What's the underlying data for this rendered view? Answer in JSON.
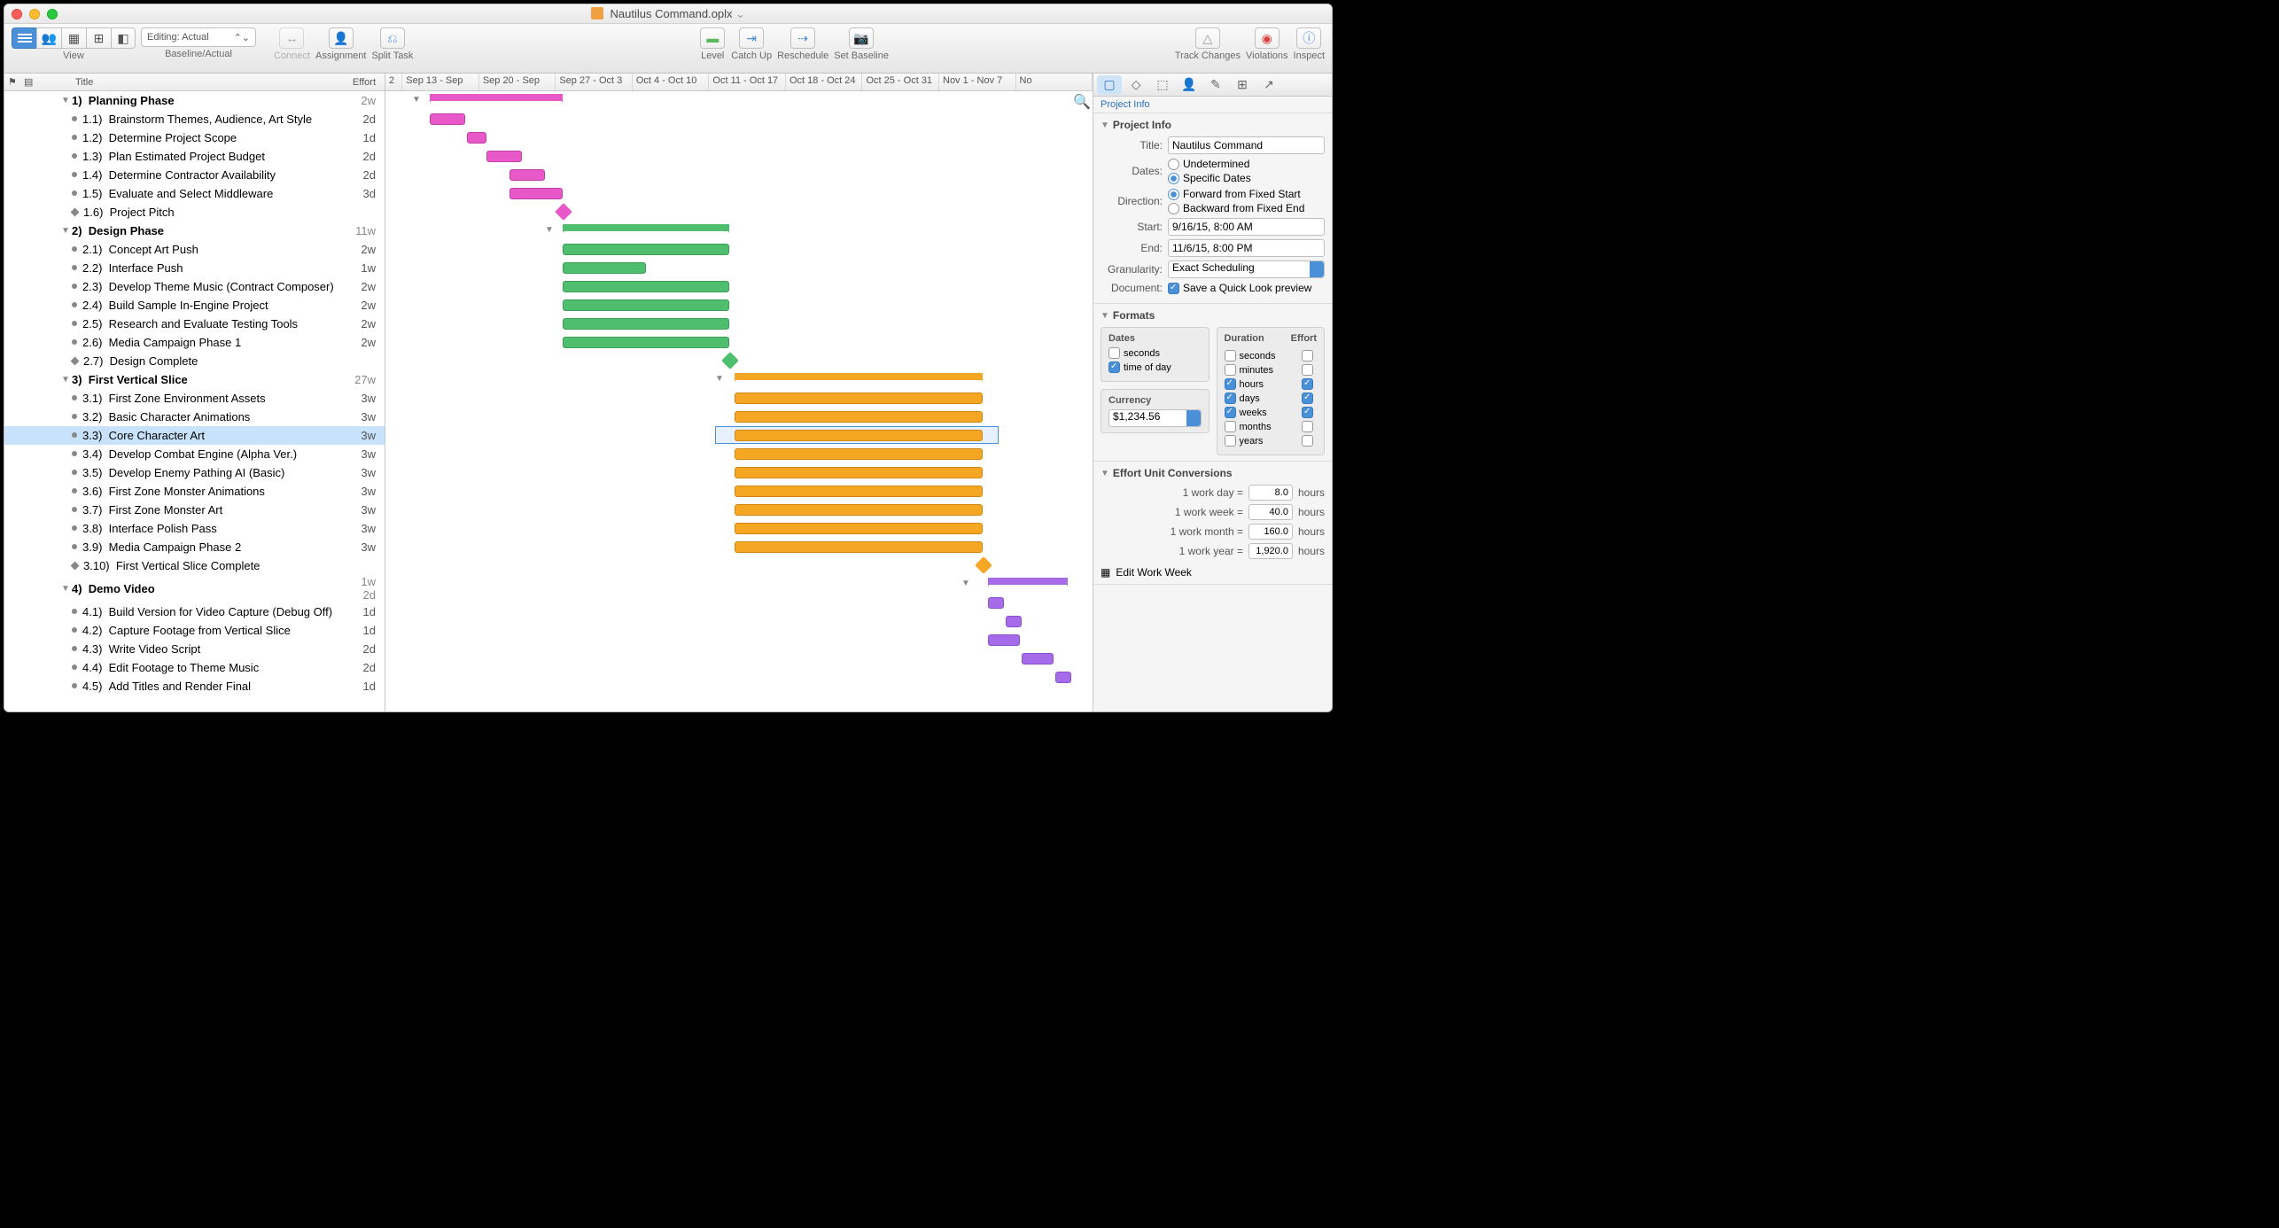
{
  "window": {
    "title": "Nautilus Command.oplx",
    "titleSuffix": "⌄"
  },
  "toolbar": {
    "view": "View",
    "baseline": "Baseline/Actual",
    "baselineSelect": "Editing: Actual",
    "connect": "Connect",
    "assignment": "Assignment",
    "split": "Split Task",
    "level": "Level",
    "catchup": "Catch Up",
    "reschedule": "Reschedule",
    "setbaseline": "Set Baseline",
    "track": "Track Changes",
    "violations": "Violations",
    "inspect": "Inspect"
  },
  "outline": {
    "headers": {
      "title": "Title",
      "effort": "Effort"
    },
    "rows": [
      {
        "type": "group",
        "id": "1",
        "label": "Planning Phase",
        "effort": "2w"
      },
      {
        "type": "task",
        "id": "1.1",
        "label": "Brainstorm Themes, Audience, Art Style",
        "effort": "2d"
      },
      {
        "type": "task",
        "id": "1.2",
        "label": "Determine Project Scope",
        "effort": "1d"
      },
      {
        "type": "task",
        "id": "1.3",
        "label": "Plan Estimated Project Budget",
        "effort": "2d"
      },
      {
        "type": "task",
        "id": "1.4",
        "label": "Determine Contractor Availability",
        "effort": "2d"
      },
      {
        "type": "task",
        "id": "1.5",
        "label": "Evaluate and Select Middleware",
        "effort": "3d"
      },
      {
        "type": "milestone",
        "id": "1.6",
        "label": "Project Pitch",
        "effort": ""
      },
      {
        "type": "group",
        "id": "2",
        "label": "Design Phase",
        "effort": "11w"
      },
      {
        "type": "task",
        "id": "2.1",
        "label": "Concept Art Push",
        "effort": "2w"
      },
      {
        "type": "task",
        "id": "2.2",
        "label": "Interface Push",
        "effort": "1w"
      },
      {
        "type": "task",
        "id": "2.3",
        "label": "Develop Theme Music (Contract Composer)",
        "effort": "2w"
      },
      {
        "type": "task",
        "id": "2.4",
        "label": "Build Sample In-Engine Project",
        "effort": "2w"
      },
      {
        "type": "task",
        "id": "2.5",
        "label": "Research and Evaluate Testing Tools",
        "effort": "2w"
      },
      {
        "type": "task",
        "id": "2.6",
        "label": "Media Campaign Phase 1",
        "effort": "2w"
      },
      {
        "type": "milestone",
        "id": "2.7",
        "label": "Design Complete",
        "effort": ""
      },
      {
        "type": "group",
        "id": "3",
        "label": "First Vertical Slice",
        "effort": "27w"
      },
      {
        "type": "task",
        "id": "3.1",
        "label": "First Zone Environment Assets",
        "effort": "3w"
      },
      {
        "type": "task",
        "id": "3.2",
        "label": "Basic Character Animations",
        "effort": "3w"
      },
      {
        "type": "task",
        "id": "3.3",
        "label": "Core Character Art",
        "effort": "3w",
        "selected": true
      },
      {
        "type": "task",
        "id": "3.4",
        "label": "Develop Combat Engine (Alpha Ver.)",
        "effort": "3w"
      },
      {
        "type": "task",
        "id": "3.5",
        "label": "Develop Enemy Pathing AI (Basic)",
        "effort": "3w"
      },
      {
        "type": "task",
        "id": "3.6",
        "label": "First Zone Monster Animations",
        "effort": "3w"
      },
      {
        "type": "task",
        "id": "3.7",
        "label": "First Zone Monster Art",
        "effort": "3w"
      },
      {
        "type": "task",
        "id": "3.8",
        "label": "Interface Polish Pass",
        "effort": "3w"
      },
      {
        "type": "task",
        "id": "3.9",
        "label": "Media Campaign Phase 2",
        "effort": "3w"
      },
      {
        "type": "milestone",
        "id": "3.10",
        "label": "First Vertical Slice Complete",
        "effort": ""
      },
      {
        "type": "group",
        "id": "4",
        "label": "Demo Video",
        "effort": "1w 2d"
      },
      {
        "type": "task",
        "id": "4.1",
        "label": "Build Version for Video Capture (Debug Off)",
        "effort": "1d"
      },
      {
        "type": "task",
        "id": "4.2",
        "label": "Capture Footage from Vertical Slice",
        "effort": "1d"
      },
      {
        "type": "task",
        "id": "4.3",
        "label": "Write Video Script",
        "effort": "2d"
      },
      {
        "type": "task",
        "id": "4.4",
        "label": "Edit Footage to Theme Music",
        "effort": "2d"
      },
      {
        "type": "task",
        "id": "4.5",
        "label": "Add Titles and Render Final",
        "effort": "1d"
      }
    ]
  },
  "timeline": {
    "columns": [
      "2",
      "Sep 13 - Sep",
      "Sep 20 - Sep",
      "Sep 27 - Oct 3",
      "Oct 4 - Oct 10",
      "Oct 11 - Oct 17",
      "Oct 18 - Oct 24",
      "Oct 25 - Oct 31",
      "Nov 1 - Nov 7",
      "No"
    ]
  },
  "inspector": {
    "panelLabel": "Project Info",
    "projectInfo": {
      "header": "Project Info",
      "titleLabel": "Title:",
      "titleValue": "Nautilus Command",
      "datesLabel": "Dates:",
      "datesUndetermined": "Undetermined",
      "datesSpecific": "Specific Dates",
      "directionLabel": "Direction:",
      "directionFwd": "Forward from Fixed Start",
      "directionBwd": "Backward from Fixed End",
      "startLabel": "Start:",
      "startValue": "9/16/15, 8:00 AM",
      "endLabel": "End:",
      "endValue": "11/6/15, 8:00 PM",
      "granLabel": "Granularity:",
      "granValue": "Exact Scheduling",
      "docLabel": "Document:",
      "docCheck": "Save a Quick Look preview"
    },
    "formats": {
      "header": "Formats",
      "datesHead": "Dates",
      "seconds": "seconds",
      "timeofday": "time of day",
      "currencyHead": "Currency",
      "currencyValue": "$1,234.56",
      "durationHead": "Duration",
      "effortHead": "Effort",
      "units": [
        "seconds",
        "minutes",
        "hours",
        "days",
        "weeks",
        "months",
        "years"
      ]
    },
    "conversions": {
      "header": "Effort Unit Conversions",
      "rows": [
        {
          "label": "1 work day =",
          "value": "8.0",
          "unit": "hours"
        },
        {
          "label": "1 work week =",
          "value": "40.0",
          "unit": "hours"
        },
        {
          "label": "1 work month =",
          "value": "160.0",
          "unit": "hours"
        },
        {
          "label": "1 work year =",
          "value": "1,920.0",
          "unit": "hours"
        }
      ],
      "editWeek": "Edit Work Week"
    }
  }
}
